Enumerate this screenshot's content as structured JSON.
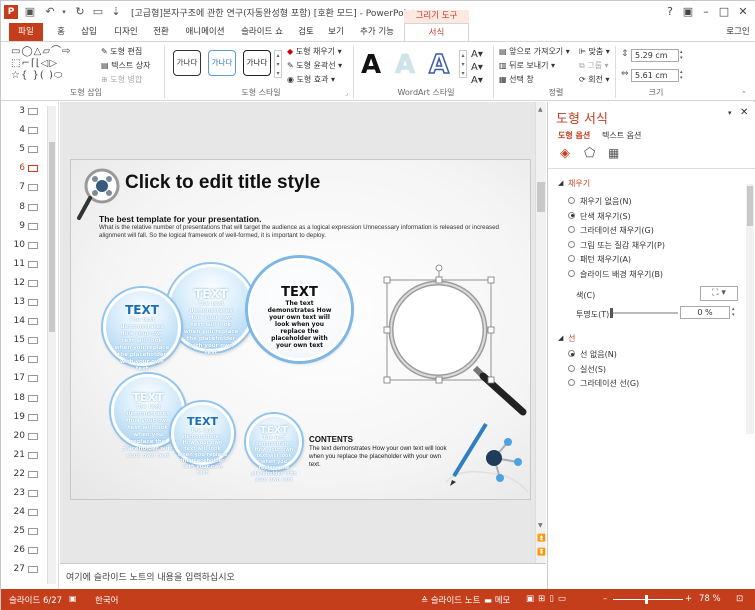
{
  "window": {
    "title": "[고급형]본자구조에 관한 연구(자동완성형 포함) [호환 모드] - PowerPoint",
    "tool_header": "그리기 도구",
    "help": "?",
    "login": "로그인"
  },
  "tabs": [
    "홈",
    "삽입",
    "디자인",
    "전환",
    "애니메이션",
    "슬라이드 쇼",
    "검토",
    "보기",
    "추가 기능"
  ],
  "tab_file": "파일",
  "tab_format": "서식",
  "ribbon": {
    "insert_group": {
      "label": "도형 삽입",
      "edit_shape": "도형 편집",
      "text_box": "텍스트 상자",
      "merge": "도형 병합"
    },
    "styles_group": {
      "label": "도형 스타일",
      "samples": [
        "가나다",
        "가나다",
        "가나다"
      ],
      "fill": "도형 채우기",
      "outline": "도형 윤곽선",
      "effects": "도형 효과"
    },
    "wordart_group": {
      "label": "WordArt 스타일",
      "letter": "A"
    },
    "arrange_group": {
      "label": "정렬",
      "bring_forward": "앞으로 가져오기",
      "send_backward": "뒤로 보내기",
      "selection_pane": "선택 창",
      "align": "맞춤",
      "group": "그룹",
      "rotate": "회전"
    },
    "size_group": {
      "label": "크기",
      "height": "5.29 cm",
      "width": "5.61 cm"
    }
  },
  "thumbnails": [
    "3",
    "4",
    "5",
    "6",
    "7",
    "8",
    "9",
    "10",
    "11",
    "12",
    "13",
    "14",
    "15",
    "16",
    "17",
    "18",
    "19",
    "20",
    "21",
    "22",
    "23",
    "24",
    "25",
    "26",
    "27"
  ],
  "selected_slide": "6",
  "slide": {
    "title": "Click to edit title style",
    "subtitle": "The best template for your presentation.",
    "body": "What is the relative number of presentations that will target the audience as a logical expression Unnecessary information is released or increased alignment will fall. So the logical framework of well-formed, it is important to deploy.",
    "bubbles": [
      {
        "title": "TEXT",
        "text": "The text demonstrates How your own text will look when you replace the placeholder with your own text"
      },
      {
        "title": "TEXT",
        "text": "The text demonstrates How your own text will look when you replace the placeholder with your own text"
      },
      {
        "title": "TEXT",
        "text": "The text demonstrates How your own text will look when you replace the placeholder with your own text"
      },
      {
        "title": "TEXT",
        "text": "The text demonstrates How your own text will look when you replace the placeholder with your own text"
      },
      {
        "title": "TEXT",
        "text": "The text demonstrates How your own text will look when you replace the placeholder with your own text"
      },
      {
        "title": "TEXT",
        "text": "The text demonstrates How your own text will look when you replace the placeholder with your own text"
      }
    ],
    "contents_title": "CONTENTS",
    "contents_text": "The text demonstrates How your own text will look when you replace the placeholder with your own text."
  },
  "notes_placeholder": "여기에 슬라이드 노트의 내용을 입력하십시오",
  "pane": {
    "title": "도형 서식",
    "tab_shape": "도형 옵션",
    "tab_text": "텍스트 옵션",
    "fill_header": "채우기",
    "fill_options": [
      "채우기 없음(N)",
      "단색 채우기(S)",
      "그라데이션 채우기(G)",
      "그림 또는 질감 채우기(P)",
      "패턴 채우기(A)",
      "슬라이드 배경 채우기(B)"
    ],
    "fill_selected": 1,
    "color_label": "색(C)",
    "transparency_label": "투명도(T)",
    "transparency_value": "0 %",
    "line_header": "선",
    "line_options": [
      "선 없음(N)",
      "실선(S)",
      "그라데이션 선(G)"
    ],
    "line_selected": 0
  },
  "status": {
    "slide": "슬라이드 6/27",
    "language": "한국어",
    "notes": "슬라이드 노트",
    "memo": "메모",
    "zoom": "78 %"
  },
  "colors": {
    "accent": "#c43e1c",
    "bubble": "#8fc4ee"
  }
}
